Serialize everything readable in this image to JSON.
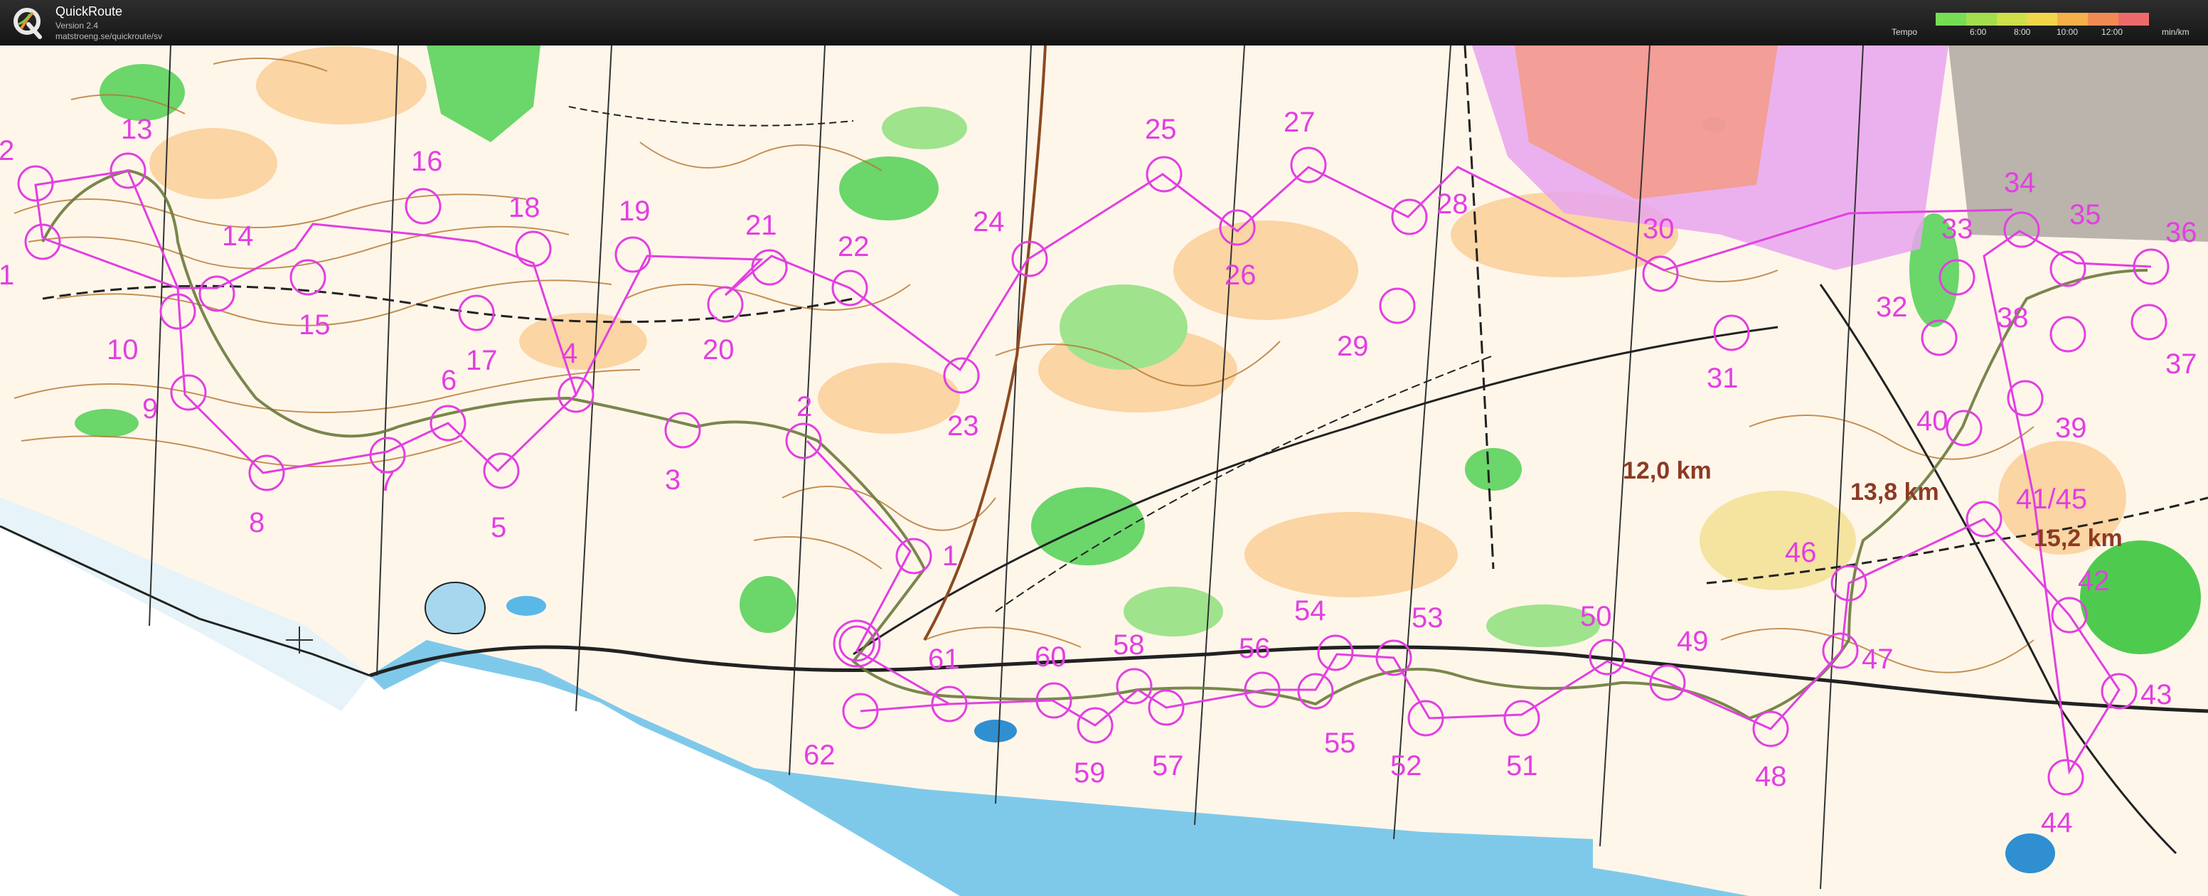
{
  "app": {
    "title": "QuickRoute",
    "version": "Version 2.4",
    "url": "matstroeng.se/quickroute/sv"
  },
  "tempo": {
    "label": "Tempo",
    "ticks": [
      "6:00",
      "8:00",
      "10:00",
      "12:00"
    ],
    "unit": "min/km",
    "colors": [
      "#77dd55",
      "#a4de4c",
      "#cfe04a",
      "#f2d64a",
      "#f5b04a",
      "#f08a55",
      "#ee6a6a"
    ]
  },
  "map": {
    "controls": [
      "1",
      "2",
      "10",
      "13",
      "14",
      "15",
      "16",
      "17",
      "18",
      "19",
      "20",
      "21",
      "22",
      "23",
      "24",
      "25",
      "26",
      "27",
      "28",
      "29",
      "30",
      "31",
      "32",
      "33",
      "34",
      "35",
      "36",
      "37",
      "38",
      "39",
      "40",
      "41/45",
      "42",
      "43",
      "44",
      "46",
      "47",
      "48",
      "49",
      "50",
      "51",
      "52",
      "53",
      "54",
      "55",
      "56",
      "57",
      "58",
      "59",
      "60",
      "61",
      "62",
      "1",
      "2",
      "3",
      "4",
      "5",
      "6",
      "7",
      "8",
      "9"
    ],
    "distances": [
      "12,0 km",
      "13,8 km",
      "15,2 km"
    ],
    "colors": {
      "course": "#e23fe2",
      "route": "#6b7a3b",
      "contour": "#b5772f",
      "water": "#a7d7ef",
      "sea": "#7ec9ea",
      "open": "#fbd5a4",
      "green": "#6bd66a",
      "distance": "#8c3b23"
    }
  }
}
